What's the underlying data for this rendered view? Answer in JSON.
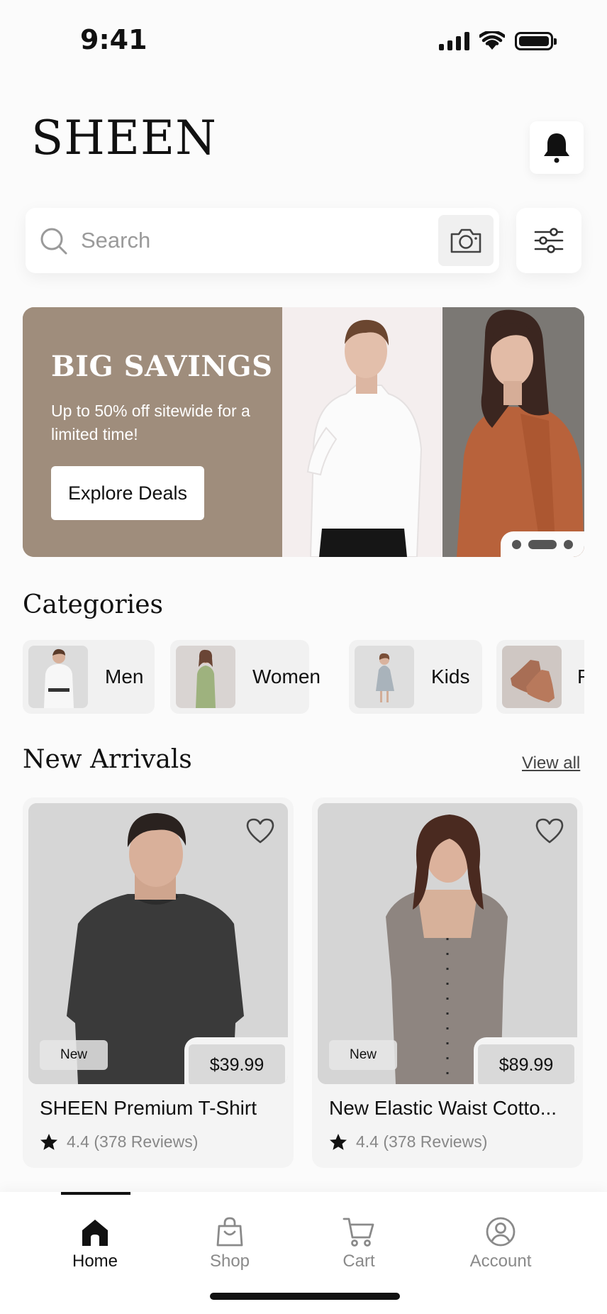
{
  "status_bar": {
    "time": "9:41"
  },
  "header": {
    "logo": "SHEEN"
  },
  "search": {
    "placeholder": "Search"
  },
  "banner": {
    "title": "BIG SAVINGS",
    "subtitle": "Up to 50% off sitewide for a limited time!",
    "cta": "Explore Deals",
    "active_slide": 2,
    "slide_count": 3
  },
  "categories": {
    "title": "Categories",
    "items": [
      {
        "label": "Men"
      },
      {
        "label": "Women"
      },
      {
        "label": "Kids"
      },
      {
        "label": "F"
      }
    ]
  },
  "new_arrivals": {
    "title": "New Arrivals",
    "view_all": "View all",
    "products": [
      {
        "badge": "New",
        "price": "$39.99",
        "name": "SHEEN Premium T-Shirt",
        "rating": "4.4",
        "reviews": "(378 Reviews)"
      },
      {
        "badge": "New",
        "price": "$89.99",
        "name": "New Elastic Waist Cotto...",
        "rating": "4.4",
        "reviews": "(378 Reviews)"
      }
    ]
  },
  "bottom_nav": {
    "items": [
      {
        "label": "Home",
        "icon": "home-icon",
        "active": true
      },
      {
        "label": "Shop",
        "icon": "shopping-bag-icon",
        "active": false
      },
      {
        "label": "Cart",
        "icon": "cart-icon",
        "active": false
      },
      {
        "label": "Account",
        "icon": "account-icon",
        "active": false
      }
    ]
  },
  "colors": {
    "banner_bg": "#9f8d7c",
    "background": "#fbfbfb",
    "accent": "#111111"
  }
}
